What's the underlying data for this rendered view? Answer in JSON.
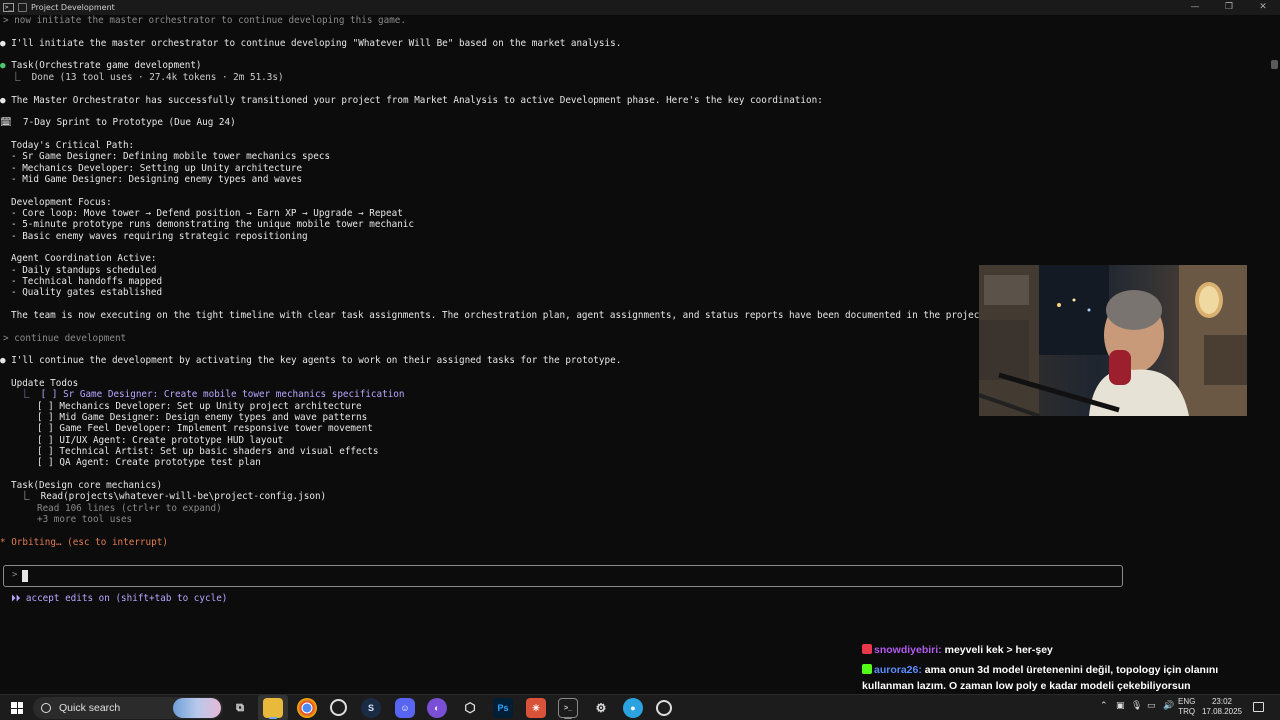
{
  "window": {
    "title": "Project Development",
    "controls": [
      "—",
      "❐",
      "✕"
    ]
  },
  "terminal": {
    "lines": [
      {
        "t": "> now initiate the master orchestrator to continue developing this game."
      },
      {
        "t": "● I'll initiate the master orchestrator to continue developing \"Whatever Will Be\" based on the market analysis."
      },
      {
        "t": "● Task(Orchestrate game development)"
      },
      {
        "t": "  ⎿  Done (13 tool uses · 27.4k tokens · 2m 51.3s)"
      },
      {
        "t": "● The Master Orchestrator has successfully transitioned your project from Market Analysis to active Development phase. Here's the key coordination:"
      },
      {
        "t": "🗓  7-Day Sprint to Prototype (Due Aug 24)"
      },
      {
        "t": "Today's Critical Path:"
      },
      {
        "t": "- Sr Game Designer: Defining mobile tower mechanics specs"
      },
      {
        "t": "- Mechanics Developer: Setting up Unity architecture"
      },
      {
        "t": "- Mid Game Designer: Designing enemy types and waves"
      },
      {
        "t": "Development Focus:"
      },
      {
        "t": "- Core loop: Move tower → Defend position → Earn XP → Upgrade → Repeat"
      },
      {
        "t": "- 5-minute prototype runs demonstrating the unique mobile tower mechanic"
      },
      {
        "t": "- Basic enemy waves requiring strategic repositioning"
      },
      {
        "t": "Agent Coordination Active:"
      },
      {
        "t": "- Daily standups scheduled"
      },
      {
        "t": "- Technical handoffs mapped"
      },
      {
        "t": "- Quality gates established"
      },
      {
        "t": "The team is now executing on the tight timeline with clear task assignments. The orchestration plan, agent assignments, and status reports have been documented in the project structu"
      },
      {
        "t": "> continue development"
      },
      {
        "t": "● I'll continue the development by activating the key agents to work on their assigned tasks for the prototype."
      },
      {
        "t": "Update Todos"
      },
      {
        "t": "  ⎿  [ ] Sr Game Designer: Create mobile tower mechanics specification"
      },
      {
        "t": "     [ ] Mechanics Developer: Set up Unity project architecture"
      },
      {
        "t": "     [ ] Mid Game Designer: Design enemy types and wave patterns"
      },
      {
        "t": "     [ ] Game Feel Developer: Implement responsive tower movement"
      },
      {
        "t": "     [ ] UI/UX Agent: Create prototype HUD layout"
      },
      {
        "t": "     [ ] Technical Artist: Set up basic shaders and visual effects"
      },
      {
        "t": "     [ ] QA Agent: Create prototype test plan"
      },
      {
        "t": "Task(Design core mechanics)"
      },
      {
        "t": "  ⎿  Read(projects\\whatever-will-be\\project-config.json)"
      },
      {
        "t": "     Read 106 lines (ctrl+r to expand)"
      },
      {
        "t": "     +3 more tool uses"
      },
      {
        "t": "* Orbiting… (esc to interrupt)"
      }
    ],
    "prompt_symbol": ">",
    "status_hint": "⏵⏵ accept edits on (shift+tab to cycle)"
  },
  "chat": [
    {
      "user": "snowdiyebiri:",
      "message": "meyveli kek > her-şey",
      "badge_color": "#e8394a"
    },
    {
      "user": "aurora26:",
      "message": "ama onun 3d model üretenenini değil, topology için olanını kullanman lazım. O zaman low poly e kadar modeli çekebiliyorsun",
      "badge_color": "#53fc18"
    }
  ],
  "taskbar": {
    "search_placeholder": "Quick search",
    "apps": [
      "task-view",
      "file-explorer",
      "chrome",
      "obs",
      "steam",
      "discord",
      "github-desktop",
      "unity",
      "photoshop",
      "app-red",
      "terminal",
      "settings",
      "app-blue",
      "clock-app"
    ],
    "language_top": "ENG",
    "language_bottom": "TRQ",
    "time": "23:02",
    "date": "17.08.2025"
  },
  "colors": {
    "background": "#0c0c0c",
    "accent_purple": "#b9a6ff",
    "orbiting_orange": "#e07b53",
    "dot_green": "#4ec46b"
  }
}
